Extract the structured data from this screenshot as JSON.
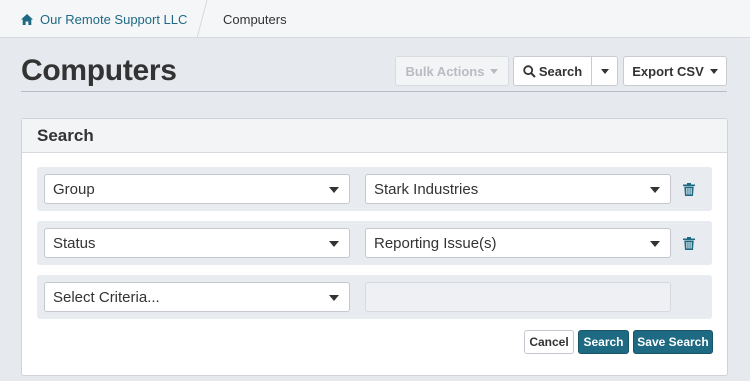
{
  "breadcrumb": {
    "home_label": "Our Remote Support LLC",
    "current_label": "Computers"
  },
  "page": {
    "title": "Computers"
  },
  "toolbar": {
    "bulk_actions_label": "Bulk Actions",
    "search_label": "Search",
    "export_label": "Export CSV"
  },
  "search_panel": {
    "title": "Search",
    "criteria": [
      {
        "field": "Group",
        "value": "Stark Industries"
      },
      {
        "field": "Status",
        "value": "Reporting Issue(s)"
      },
      {
        "field": "Select Criteria...",
        "value": ""
      }
    ],
    "cancel_label": "Cancel",
    "search_label": "Search",
    "save_label": "Save Search"
  },
  "colors": {
    "accent": "#1e6a82",
    "link": "#1f6a83",
    "background": "#e6e9ee"
  },
  "icons": [
    "home-icon",
    "search-icon",
    "caret-down-icon",
    "trash-icon"
  ]
}
